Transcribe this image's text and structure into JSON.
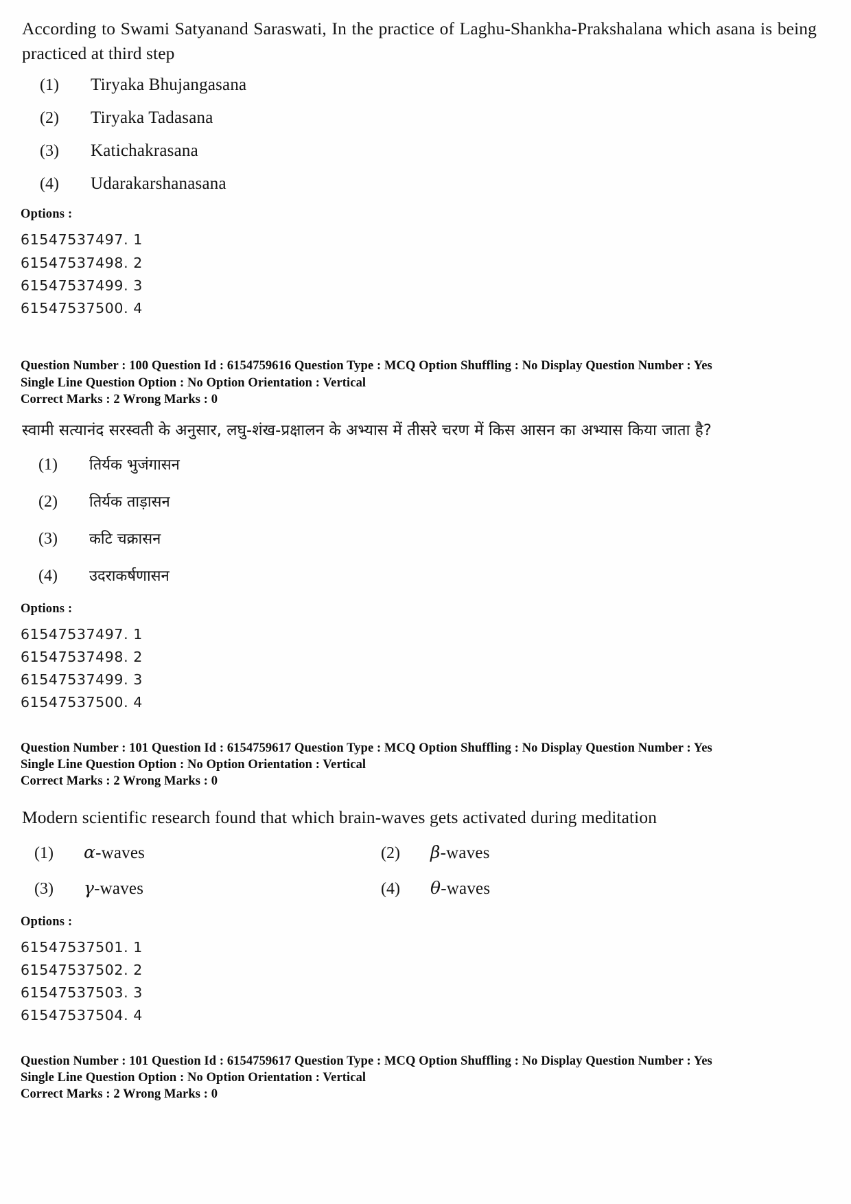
{
  "document": {
    "type": "exam-question-paper"
  },
  "questions": [
    {
      "stem": "According to Swami Satyanand Saraswati, In the practice of Laghu-Shankha-Prakshalana which asana is being practiced at third step",
      "options": [
        {
          "num": "(1)",
          "text": "Tiryaka Bhujangasana"
        },
        {
          "num": "(2)",
          "text": "Tiryaka Tadasana"
        },
        {
          "num": "(3)",
          "text": "Katichakrasana"
        },
        {
          "num": "(4)",
          "text": "Udarakarshanasana"
        }
      ],
      "options_label": "Options :",
      "option_ids": [
        "61547537497. 1",
        "61547537498. 2",
        "61547537499. 3",
        "61547537500. 4"
      ],
      "meta": {
        "line1": "Question Number : 100  Question Id : 6154759616  Question Type : MCQ  Option Shuffling : No  Display Question Number : Yes",
        "line2": "Single Line Question Option : No  Option Orientation : Vertical",
        "line3": "Correct Marks : 2  Wrong Marks : 0"
      }
    },
    {
      "stem": "स्वामी सत्यानंद सरस्वती के अनुसार, लघु-शंख-प्रक्षालन के अभ्यास में तीसरे चरण में किस आसन का अभ्यास किया जाता है?",
      "options": [
        {
          "num": "(1)",
          "text": "तिर्यक भुजंगासन"
        },
        {
          "num": "(2)",
          "text": "तिर्यक ताड़ासन"
        },
        {
          "num": "(3)",
          "text": "कटि चक्रासन"
        },
        {
          "num": "(4)",
          "text": "उदराकर्षणासन"
        }
      ],
      "options_label": "Options :",
      "option_ids": [
        "61547537497. 1",
        "61547537498. 2",
        "61547537499. 3",
        "61547537500. 4"
      ],
      "meta": {
        "line1": "Question Number : 101  Question Id : 6154759617  Question Type : MCQ  Option Shuffling : No  Display Question Number : Yes",
        "line2": "Single Line Question Option : No  Option Orientation : Vertical",
        "line3": "Correct Marks : 2  Wrong Marks : 0"
      }
    },
    {
      "stem": "Modern scientific research found that which brain-waves gets activated during meditation",
      "options": [
        {
          "num": "(1)",
          "greek": "α",
          "text": "-waves"
        },
        {
          "num": "(2)",
          "greek": "β",
          "text": "-waves"
        },
        {
          "num": "(3)",
          "greek": "γ",
          "text": "-waves"
        },
        {
          "num": "(4)",
          "greek": "θ",
          "text": "-waves"
        }
      ],
      "options_label": "Options :",
      "option_ids": [
        "61547537501. 1",
        "61547537502. 2",
        "61547537503. 3",
        "61547537504. 4"
      ],
      "meta": {
        "line1": "Question Number : 101  Question Id : 6154759617  Question Type : MCQ  Option Shuffling : No  Display Question Number : Yes",
        "line2": "Single Line Question Option : No  Option Orientation : Vertical",
        "line3": "Correct Marks : 2  Wrong Marks : 0"
      }
    }
  ]
}
